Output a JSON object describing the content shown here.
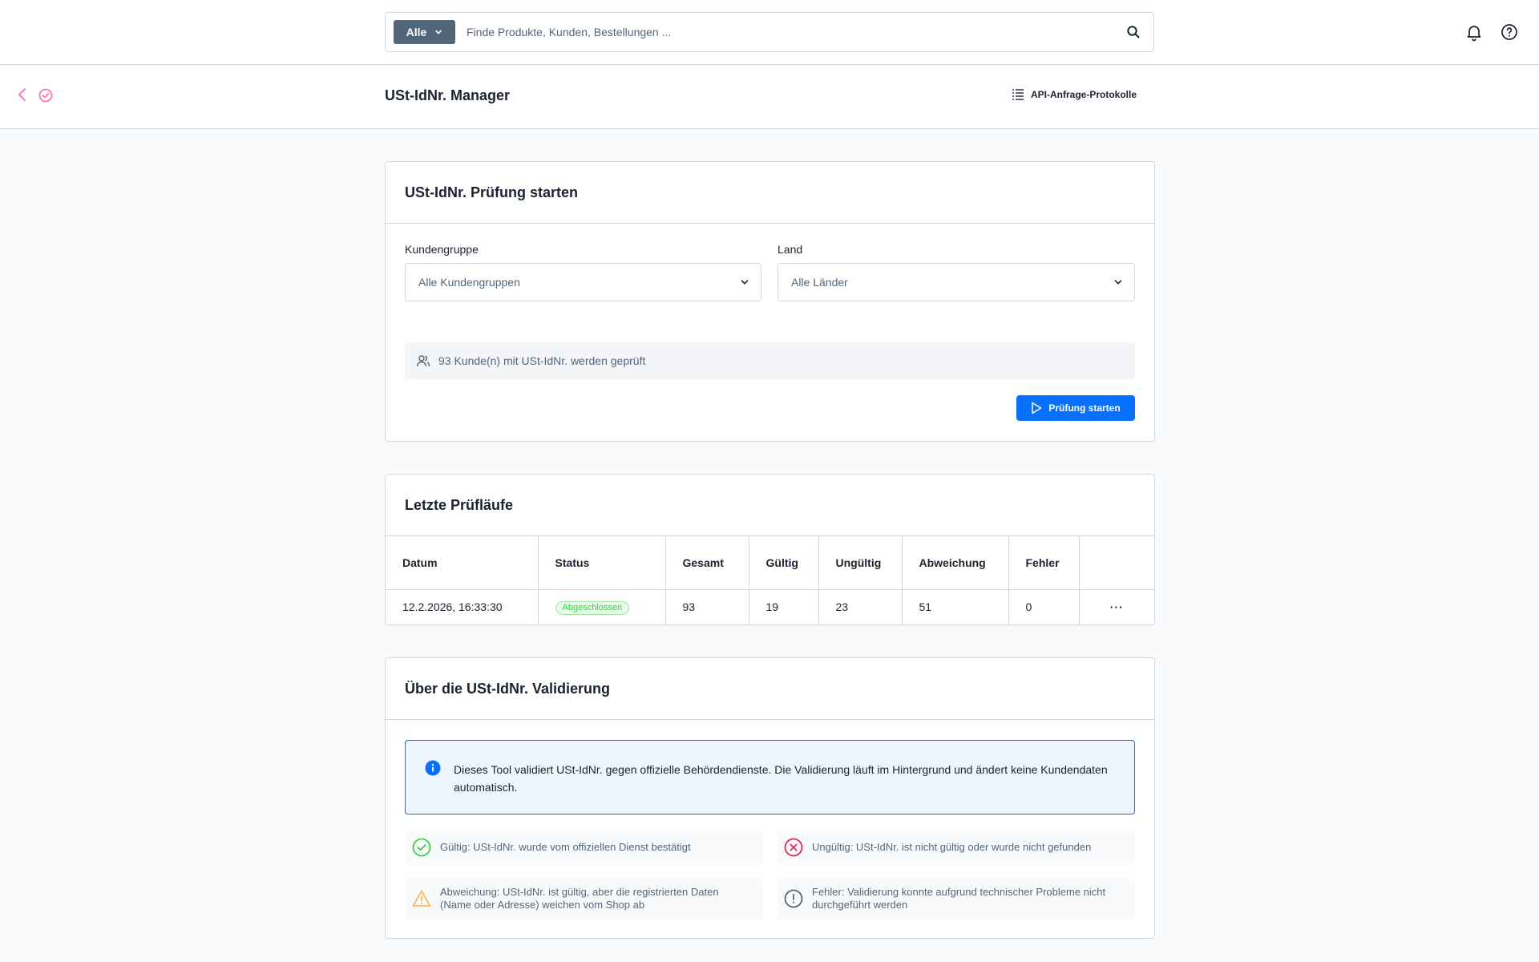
{
  "search": {
    "type_label": "Alle",
    "placeholder": "Finde Produkte, Kunden, Bestellungen ..."
  },
  "header": {
    "title": "USt-IdNr. Manager",
    "api_link": "API-Anfrage-Protokolle"
  },
  "start_card": {
    "title": "USt-IdNr. Prüfung starten",
    "customer_group_label": "Kundengruppe",
    "customer_group_value": "Alle Kundengruppen",
    "country_label": "Land",
    "country_value": "Alle Länder",
    "info": "93 Kunde(n) mit USt-IdNr. werden geprüft",
    "start_button": "Prüfung starten"
  },
  "runs_card": {
    "title": "Letzte Prüfläufe",
    "columns": [
      "Datum",
      "Status",
      "Gesamt",
      "Gültig",
      "Ungültig",
      "Abweichung",
      "Fehler"
    ],
    "rows": [
      {
        "date": "12.2.2026, 16:33:30",
        "status": "Abgeschlossen",
        "total": "93",
        "valid": "19",
        "invalid": "23",
        "deviation": "51",
        "errors": "0",
        "actions": "···"
      }
    ]
  },
  "about_card": {
    "title": "Über die USt-IdNr. Validierung",
    "info_text": "Dieses Tool validiert USt-IdNr. gegen offizielle Behördendienste. Die Validierung läuft im Hintergrund und ändert keine Kundendaten automatisch.",
    "legend": {
      "valid": "Gültig: USt-IdNr. wurde vom offiziellen Dienst bestätigt",
      "invalid": "Ungültig: USt-IdNr. ist nicht gültig oder wurde nicht gefunden",
      "deviation": "Abweichung: USt-IdNr. ist gültig, aber die registrierten Daten (Name oder Adresse) weichen vom Shop ab",
      "error": "Fehler: Validierung konnte aufgrund technischer Probleme nicht durchgeführt werden"
    }
  },
  "colors": {
    "accent": "#0870ff",
    "valid": "#37d046",
    "invalid": "#de294c",
    "warning": "#ffb75d",
    "neutral": "#52667a",
    "module": "#ff68b4"
  },
  "icons": [
    "search-icon",
    "bell-icon",
    "help-icon",
    "back-icon",
    "module-check-icon",
    "list-icon",
    "chevron-down-icon",
    "users-icon",
    "play-icon",
    "info-icon",
    "check-circle-icon",
    "x-circle-icon",
    "warning-icon",
    "exclamation-circle-icon"
  ]
}
